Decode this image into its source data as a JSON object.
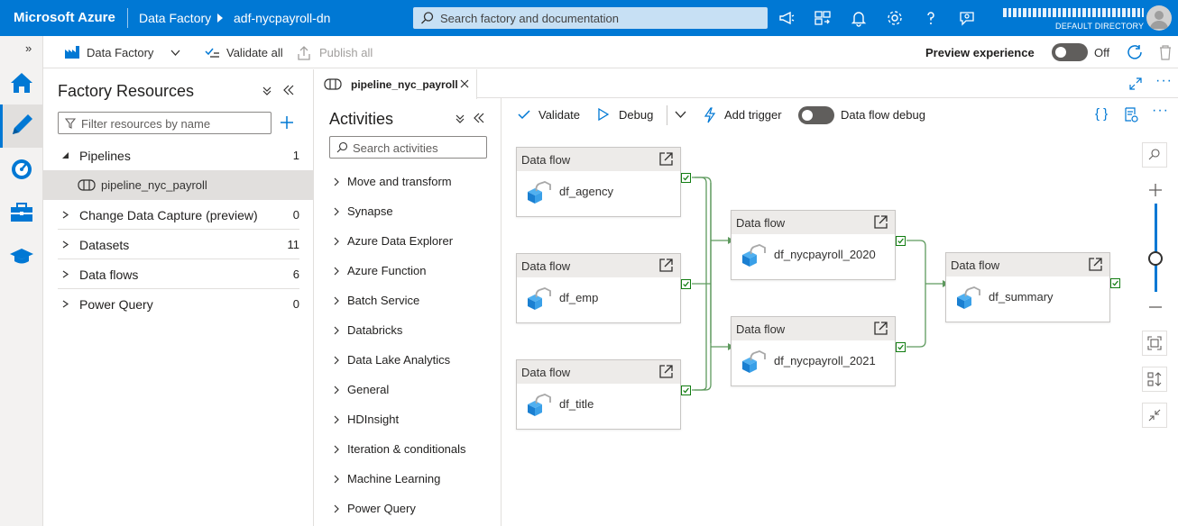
{
  "topbar": {
    "brand": "Microsoft Azure",
    "breadcrumb_service": "Data Factory",
    "breadcrumb_factory": "adf-nycpayroll-dn",
    "search_placeholder": "Search factory and documentation",
    "directory": "DEFAULT DIRECTORY"
  },
  "commandbar": {
    "factory_label": "Data Factory",
    "validate_all": "Validate all",
    "publish_all": "Publish all",
    "preview_label": "Preview experience",
    "preview_state": "Off"
  },
  "resources": {
    "title": "Factory Resources",
    "filter_placeholder": "Filter resources by name",
    "items": [
      {
        "label": "Pipelines",
        "count": "1"
      },
      {
        "label": "Change Data Capture (preview)",
        "count": "0"
      },
      {
        "label": "Datasets",
        "count": "11"
      },
      {
        "label": "Data flows",
        "count": "6"
      },
      {
        "label": "Power Query",
        "count": "0"
      }
    ],
    "pipeline_child": "pipeline_nyc_payroll"
  },
  "tab": {
    "label": "pipeline_nyc_payroll"
  },
  "activities": {
    "title": "Activities",
    "search_placeholder": "Search activities",
    "items": [
      "Move and transform",
      "Synapse",
      "Azure Data Explorer",
      "Azure Function",
      "Batch Service",
      "Databricks",
      "Data Lake Analytics",
      "General",
      "HDInsight",
      "Iteration & conditionals",
      "Machine Learning",
      "Power Query"
    ]
  },
  "canvas_toolbar": {
    "validate": "Validate",
    "debug": "Debug",
    "add_trigger": "Add trigger",
    "dataflow_debug": "Data flow debug"
  },
  "nodes": [
    {
      "type": "Data flow",
      "name": "df_agency"
    },
    {
      "type": "Data flow",
      "name": "df_emp"
    },
    {
      "type": "Data flow",
      "name": "df_title"
    },
    {
      "type": "Data flow",
      "name": "df_nycpayroll_2020"
    },
    {
      "type": "Data flow",
      "name": "df_nycpayroll_2021"
    },
    {
      "type": "Data flow",
      "name": "df_summary"
    }
  ],
  "colors": {
    "azure_blue": "#0078d4",
    "success_green": "#107c10",
    "connector_green": "#5e9a5e"
  }
}
